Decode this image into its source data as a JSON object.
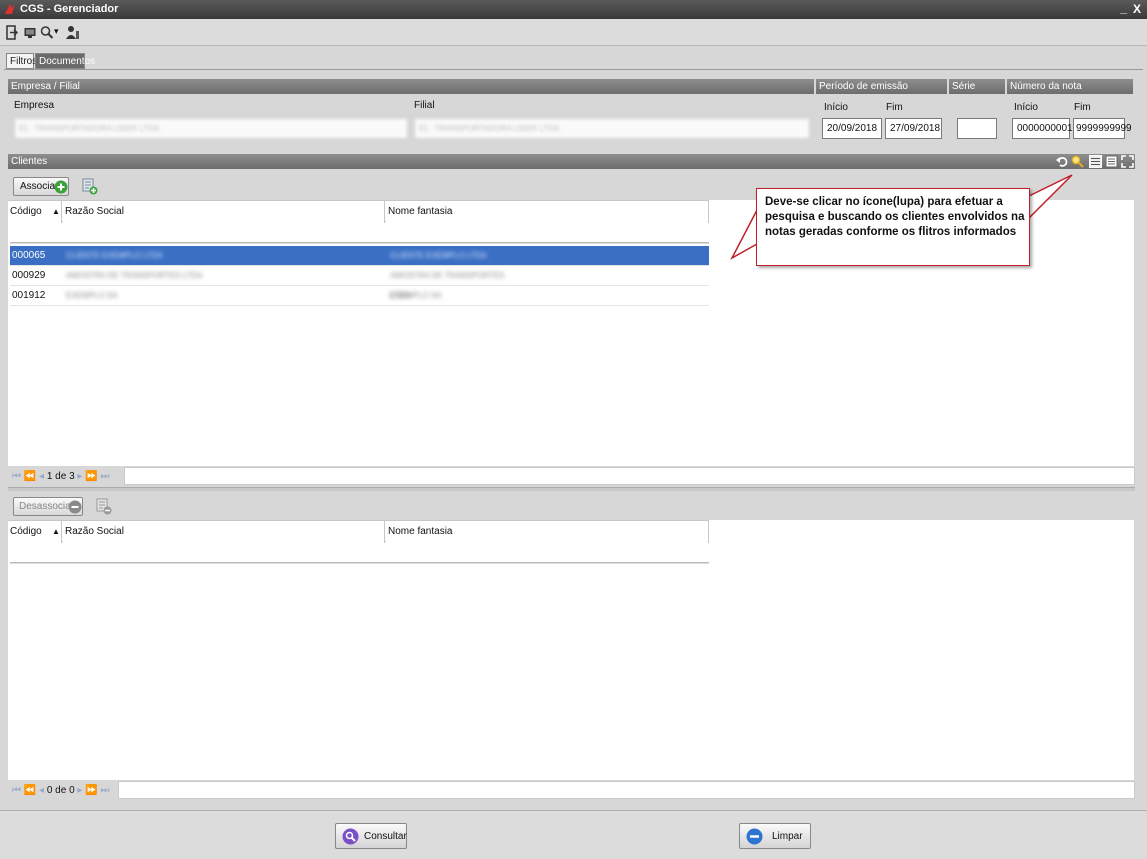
{
  "window": {
    "title": "CGS - Gerenciador",
    "minimize": "_",
    "close": "X"
  },
  "toolbar": {
    "icons": [
      "exit-icon",
      "screen-icon",
      "search-icon",
      "user-icon"
    ],
    "dropdown_arrow": "▾"
  },
  "tabs": [
    {
      "label": "Filtros",
      "active": true
    },
    {
      "label": "Documentos",
      "active": false
    }
  ],
  "filters": {
    "empresa_filial": {
      "header": "Empresa / Filial",
      "empresa_label": "Empresa",
      "filial_label": "Filial",
      "empresa_value": "01 - TRANSPORTADORA LIDER LTDA",
      "filial_value": "01 - TRANSPORTADORA LIDER LTDA"
    },
    "periodo": {
      "header": "Período de emissão",
      "inicio_label": "Início",
      "fim_label": "Fim",
      "inicio_value": "20/09/2018",
      "fim_value": "27/09/2018"
    },
    "serie": {
      "header": "Série",
      "value": ""
    },
    "numero_nota": {
      "header": "Número da nota",
      "inicio_label": "Início",
      "fim_label": "Fim",
      "inicio_value": "0000000001",
      "fim_value": "9999999999"
    }
  },
  "clientes": {
    "header": "Clientes",
    "associar_label": "Associar",
    "desassociar_label": "Desassociar",
    "columns": {
      "codigo": "Código",
      "sort_arrow": "▲",
      "razao_social": "Razão Social",
      "nome_fantasia": "Nome fantasia"
    },
    "rows": [
      {
        "codigo": "000065",
        "razao_social": "CLIENTE EXEMPLO LTDA",
        "nome_fantasia": "CLIENTE EXEMPLO LTDA",
        "selected": true
      },
      {
        "codigo": "000929",
        "razao_social": "AMOSTRA DE TRANSPORTES LTDA",
        "nome_fantasia": "AMOSTRA DE TRANSPORTES LTDA",
        "selected": false
      },
      {
        "codigo": "001912",
        "razao_social": "EXEMPLO SA",
        "nome_fantasia": "EXEMPLO SA",
        "selected": false
      }
    ],
    "pager_top": {
      "text": "1 de 3"
    },
    "pager_bottom": {
      "text": "0 de 0"
    }
  },
  "callout": {
    "text": "Deve-se clicar no ícone(lupa) para efetuar a pesquisa e buscando os clientes envolvidos na notas geradas conforme os flitros informados",
    "border_color": "#c0202a"
  },
  "actions": {
    "consultar_label": "Consultar",
    "limpar_label": "Limpar"
  },
  "colors": {
    "selection": "#3a6fc4",
    "header_gray": "#7a7a7a",
    "add_green": "#3aa23a",
    "accent_red": "#c0202a"
  }
}
